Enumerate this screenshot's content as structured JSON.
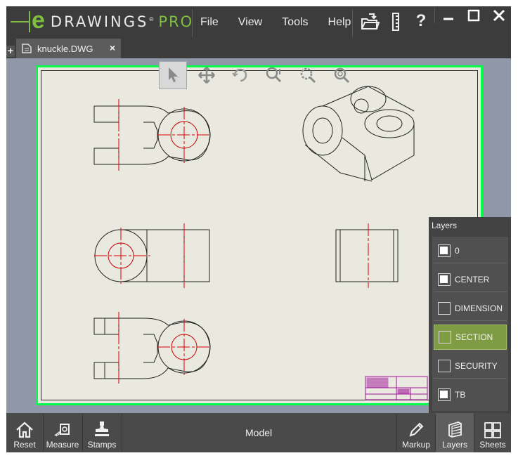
{
  "app": {
    "logo_letter": "e",
    "logo_word": "DRAWINGS",
    "logo_reg": "®",
    "logo_edition": "PRO",
    "accent_color": "#7fbf3f"
  },
  "menu": {
    "items": [
      {
        "label": "File"
      },
      {
        "label": "View"
      },
      {
        "label": "Tools"
      },
      {
        "label": "Help"
      }
    ]
  },
  "title_icons": {
    "open": "open-folder-icon",
    "ruler": "ruler-icon",
    "help": "?"
  },
  "window_controls": {
    "minimize": "minimize-icon",
    "maximize": "maximize-icon",
    "close": "close-icon"
  },
  "tabs": {
    "add": "+",
    "items": [
      {
        "label": "knuckle.DWG",
        "close": "×"
      }
    ]
  },
  "view_tools": [
    {
      "name": "select-arrow-icon"
    },
    {
      "name": "pan-icon"
    },
    {
      "name": "rotate-icon"
    },
    {
      "name": "zoom-icon"
    },
    {
      "name": "zoom-to-area-icon"
    },
    {
      "name": "zoom-to-fit-icon"
    }
  ],
  "layers": {
    "title": "Layers",
    "items": [
      {
        "name": "0",
        "checked": true,
        "selected": false
      },
      {
        "name": "CENTER",
        "checked": true,
        "selected": false
      },
      {
        "name": "DIMENSION",
        "checked": false,
        "selected": false
      },
      {
        "name": "SECTION",
        "checked": false,
        "selected": true
      },
      {
        "name": "SECURITY",
        "checked": false,
        "selected": false
      },
      {
        "name": "TB",
        "checked": true,
        "selected": false
      }
    ]
  },
  "bottom_toolbar": {
    "reset": "Reset",
    "measure": "Measure",
    "stamps": "Stamps",
    "model": "Model",
    "markup": "Markup",
    "layers": "Layers",
    "sheets": "Sheets"
  }
}
